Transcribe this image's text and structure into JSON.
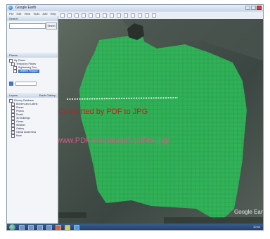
{
  "window": {
    "title": "Google Earth"
  },
  "menu": [
    "File",
    "Edit",
    "View",
    "Tools",
    "Add",
    "Help"
  ],
  "sidebar": {
    "search_header": "Search",
    "search_button": "Search",
    "places_header": "Places",
    "places": [
      {
        "label": "My Places",
        "selected": false
      },
      {
        "label": "Temporary Places",
        "selected": false
      },
      {
        "label": "Sightseeing Tour",
        "selected": false
      },
      {
        "label": "Untitled Polygon",
        "selected": true
      }
    ],
    "layers_header": "Layers",
    "layers_gallery": "Earth Gallery",
    "layers": [
      "Primary Database",
      "Borders and Labels",
      "Places",
      "Photos",
      "Roads",
      "3D Buildings",
      "Ocean",
      "Weather",
      "Gallery",
      "Global Awareness",
      "More"
    ]
  },
  "map": {
    "watermark_line1": "Converted by PDF to JPG",
    "watermark_line2": "http://www.PDF-Helper.com/pdf-to-jpg/",
    "logo": "Google Earth",
    "polygon_color": "#2fbf5a"
  },
  "taskbar": {
    "clock": "10:44"
  }
}
